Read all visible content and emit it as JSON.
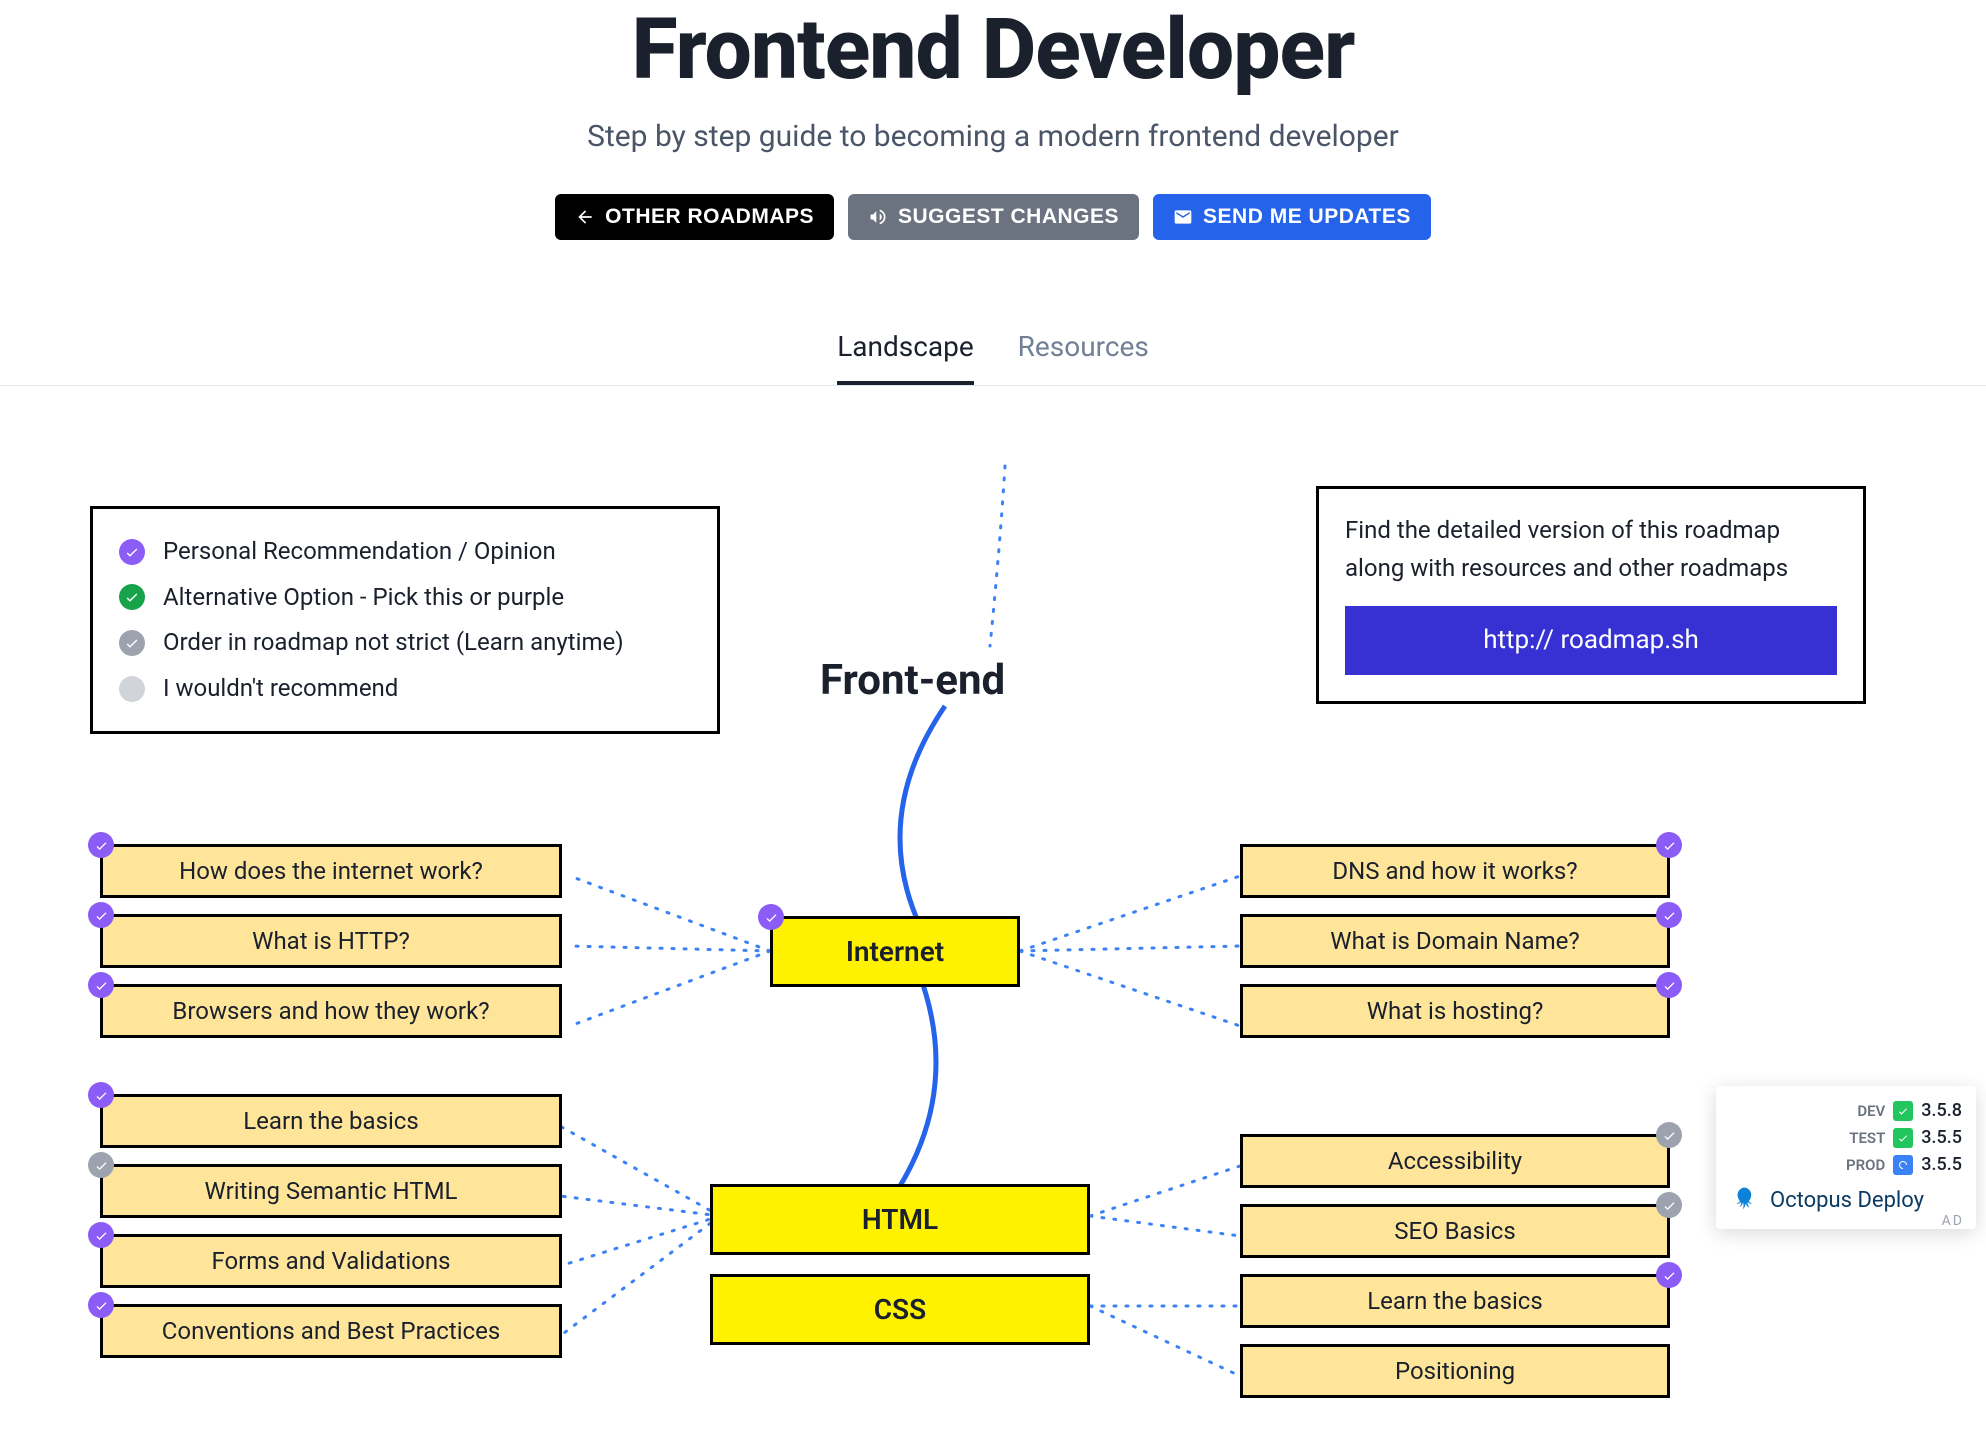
{
  "header": {
    "title": "Frontend Developer",
    "subtitle": "Step by step guide to becoming a modern frontend developer",
    "buttons": {
      "other": "OTHER ROADMAPS",
      "suggest": "SUGGEST CHANGES",
      "updates": "SEND ME UPDATES"
    }
  },
  "tabs": {
    "landscape": "Landscape",
    "resources": "Resources"
  },
  "legend": {
    "items": [
      "Personal Recommendation / Opinion",
      "Alternative Option - Pick this or purple",
      "Order in roadmap not strict (Learn anytime)",
      "I wouldn't recommend"
    ]
  },
  "info": {
    "text": "Find the detailed version of this roadmap along with resources and other roadmaps",
    "link": "http:// roadmap.sh"
  },
  "roadmap": {
    "title": "Front-end",
    "main": {
      "internet": "Internet",
      "html": "HTML",
      "css": "CSS"
    },
    "subs": {
      "internet_left": [
        "How does the internet work?",
        "What is HTTP?",
        "Browsers and how they work?"
      ],
      "internet_right": [
        "DNS and how it works?",
        "What is Domain Name?",
        "What is hosting?"
      ],
      "html_left": [
        "Learn the basics",
        "Writing Semantic HTML",
        "Forms and Validations",
        "Conventions and Best Practices"
      ],
      "htmlcss_right": [
        "Accessibility",
        "SEO Basics",
        "Learn the basics",
        "Positioning"
      ]
    }
  },
  "ad": {
    "envs": [
      {
        "label": "DEV",
        "version": "3.5.8",
        "status": "green"
      },
      {
        "label": "TEST",
        "version": "3.5.5",
        "status": "green"
      },
      {
        "label": "PROD",
        "version": "3.5.5",
        "status": "blue"
      }
    ],
    "brand": "Octopus Deploy",
    "tag": "AD"
  }
}
